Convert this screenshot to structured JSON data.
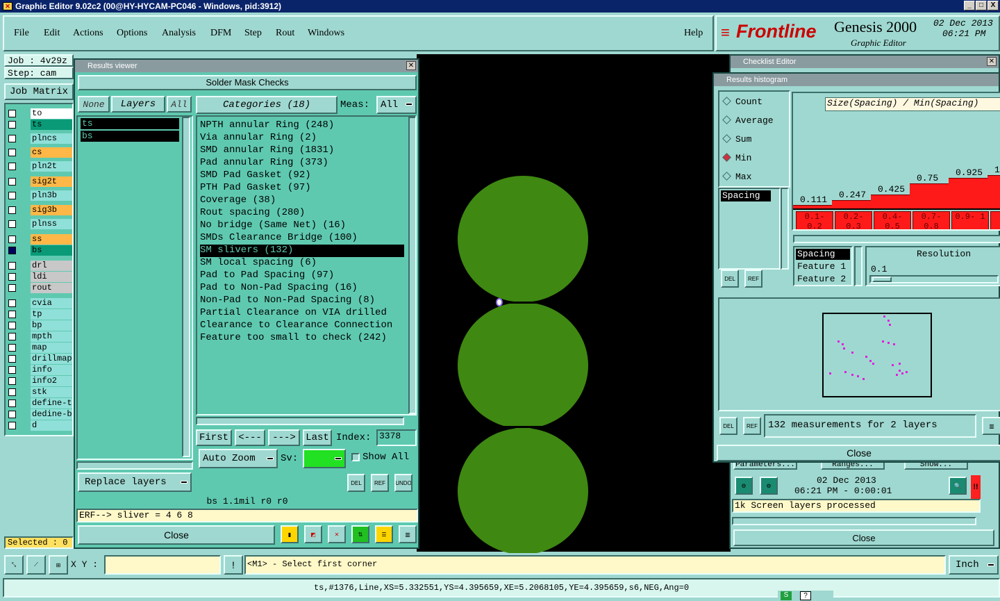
{
  "window": {
    "title": "Graphic Editor 9.02c2 (00@HY-HYCAM-PC046 - Windows, pid:3912)",
    "min": "_",
    "max": "□",
    "close": "X"
  },
  "menu": {
    "items": [
      "File",
      "Edit",
      "Actions",
      "Options",
      "Analysis",
      "DFM",
      "Step",
      "Rout",
      "Windows"
    ],
    "help": "Help"
  },
  "brand": {
    "logo": "Frontline",
    "product": "Genesis 2000",
    "sub": "Graphic Editor",
    "date": "02 Dec 2013",
    "time": "06:21 PM"
  },
  "left_panel": {
    "job": "Job : 4v29z",
    "step": "Step: cam",
    "job_matrix": "Job Matrix",
    "selected": "Selected : 0",
    "layers": [
      {
        "name": "to",
        "color": "#ffffff"
      },
      {
        "name": "ts",
        "color": "#0a9a78"
      },
      {
        "name": "plncs",
        "color": "#8fe0d8"
      },
      {
        "name": "cs",
        "color": "#ffb848"
      },
      {
        "name": "pln2t",
        "color": "#8fe0d8"
      },
      {
        "name": "sig2t",
        "color": "#ffb848"
      },
      {
        "name": "pln3b",
        "color": "#8fe0d8"
      },
      {
        "name": "sig3b",
        "color": "#ffb848"
      },
      {
        "name": "plnss",
        "color": "#8fe0d8"
      },
      {
        "name": "ss",
        "color": "#ffb848"
      },
      {
        "name": "bs",
        "color": "#0a9a78"
      },
      {
        "name": "drl",
        "color": "#c8c8c8"
      },
      {
        "name": "ldi",
        "color": "#c8c8c8"
      },
      {
        "name": "rout",
        "color": "#c8c8c8"
      },
      {
        "name": "cvia",
        "color": "#8fe0d8"
      },
      {
        "name": "tp",
        "color": "#8fe0d8"
      },
      {
        "name": "bp",
        "color": "#8fe0d8"
      },
      {
        "name": "mpth",
        "color": "#8fe0d8"
      },
      {
        "name": "map",
        "color": "#8fe0d8"
      },
      {
        "name": "drillmap",
        "color": "#8fe0d8"
      },
      {
        "name": "info",
        "color": "#8fe0d8"
      },
      {
        "name": "info2",
        "color": "#8fe0d8"
      },
      {
        "name": "stk",
        "color": "#8fe0d8"
      },
      {
        "name": "define-t",
        "color": "#8fe0d8"
      },
      {
        "name": "dedine-b",
        "color": "#8fe0d8"
      },
      {
        "name": "d",
        "color": "#8fe0d8"
      }
    ]
  },
  "results_viewer": {
    "title": "Results viewer",
    "heading": "Solder Mask Checks",
    "none": "None",
    "layers": "Layers",
    "all": "All",
    "categories_btn": "Categories (18)",
    "meas_label": "Meas:",
    "meas_value": "All",
    "layer_list": [
      "ts",
      "bs"
    ],
    "categories": [
      "NPTH annular Ring (248)",
      "Via annular Ring (2)",
      "SMD annular Ring (1831)",
      "Pad annular Ring (373)",
      "SMD Pad Gasket (92)",
      "PTH Pad Gasket (97)",
      "Coverage (38)",
      "Rout spacing (280)",
      "No bridge (Same Net) (16)",
      "SMDs Clearance Bridge (100)",
      "SM slivers (132)",
      "SM local spacing (6)",
      "Pad to Pad Spacing (97)",
      "Pad to Non-Pad Spacing (16)",
      "Non-Pad to Non-Pad Spacing (8)",
      "Partial Clearance on VIA drilled",
      "Clearance to Clearance Connection",
      "Feature too small to check (242)"
    ],
    "selected_index": 10,
    "first": "First",
    "prev": "<---",
    "next": "--->",
    "last": "Last",
    "index_label": "Index:",
    "index_value": "3378",
    "auto_zoom": "Auto Zoom",
    "sv": "Sv:",
    "show_all": "Show All",
    "replace_layers": "Replace layers",
    "del": "DEL",
    "ref": "REF",
    "undo": "UNDO",
    "status": "bs 1.1mil  r0  r0",
    "erf": "ERF--> sliver = 4 6 8",
    "close": "Close"
  },
  "checklist": {
    "title": "Checklist Editor",
    "buttons": [
      "Parameters...",
      "Ranges...",
      "Show..."
    ],
    "date": "02 Dec 2013",
    "time": "06:21 PM - 0:00:01",
    "status": "1k Screen layers processed",
    "close": "Close"
  },
  "histogram": {
    "title": "Results histogram",
    "modes": [
      "Count",
      "Average",
      "Sum",
      "Min",
      "Max"
    ],
    "selected_mode": "Min",
    "header": "Size(Spacing) / Min(Spacing)",
    "meas_list": [
      "Spacing"
    ],
    "bars": [
      {
        "label": "0.111",
        "value": 0.111,
        "bin": "0.1- 0.2"
      },
      {
        "label": "0.247",
        "value": 0.247,
        "bin": "0.2- 0.3"
      },
      {
        "label": "0.425",
        "value": 0.425,
        "bin": "0.4- 0.5"
      },
      {
        "label": "0.75",
        "value": 0.75,
        "bin": "0.7- 0.8"
      },
      {
        "label": "0.925",
        "value": 0.925,
        "bin": "0.9- 1"
      },
      {
        "label": "1",
        "value": 1.0,
        "bin": "1"
      }
    ],
    "fields": [
      "Spacing",
      "Feature 1",
      "Feature 2"
    ],
    "resolution_label": "Resolution",
    "resolution_value": "0.1",
    "summary": "132 measurements for 2 layers",
    "del": "DEL",
    "ref": "REF",
    "close": "Close"
  },
  "bottom": {
    "xy_label": "X Y :",
    "xy_value": "",
    "prompt": "<M1> - Select first corner",
    "units": "Inch",
    "status": "ts,#1376,Line,XS=5.332551,YS=4.395659,XE=5.2068105,YE=4.395659,s6,NEG,Ang=0"
  }
}
